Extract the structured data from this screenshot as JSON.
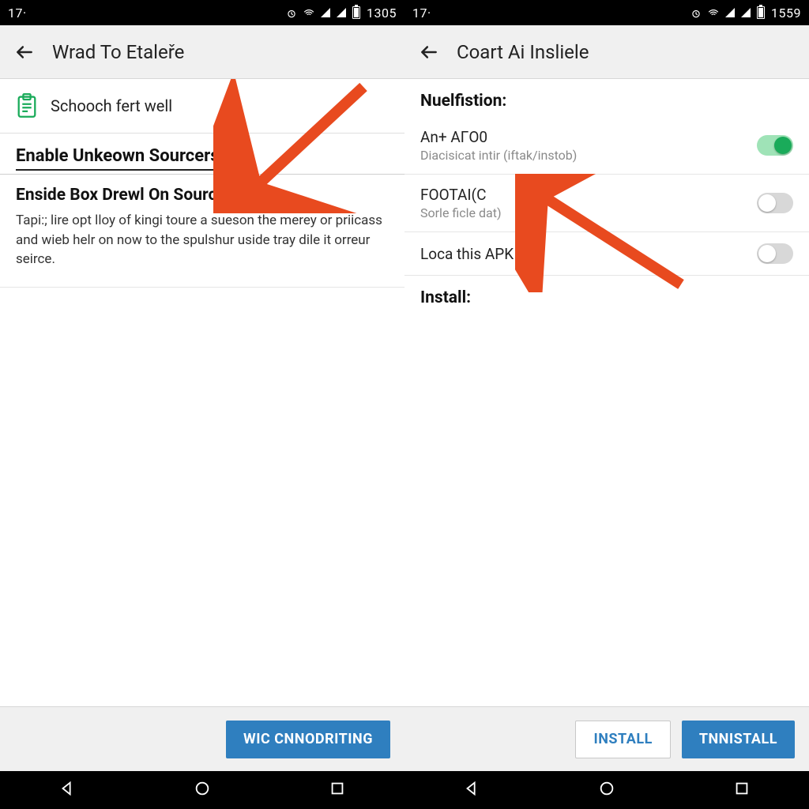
{
  "colors": {
    "accent_blue": "#2f7fbf",
    "accent_green": "#1aab5a",
    "arrow": "#e84a1f"
  },
  "left": {
    "statusbar": {
      "left": "17·",
      "time": "1305"
    },
    "appbar": {
      "title": "Wrad To Etaleře"
    },
    "row1": {
      "label": "Schooch fert well"
    },
    "section_title": "Enable Unkeown Sourcers",
    "para": {
      "heading": "Enside Box Drewl On Sourcer",
      "body": "Tapi:; lire opt lloy of kingi toure a sueson the merey or priicass and wieb helr on now to the spulshur uside tray dile it orreur seirce."
    },
    "footer": {
      "primary": "WIC CNNODRITING"
    }
  },
  "right": {
    "statusbar": {
      "left": "17·",
      "time": "1559"
    },
    "appbar": {
      "title": "Coart Ai Insliele"
    },
    "heading1": "Nuelfistion:",
    "settings": [
      {
        "title": "An+ AΓO0",
        "subtitle": "Diacisicat intir (iftak/instob)",
        "on": true
      },
      {
        "title": "FOOTAI(C",
        "subtitle": "Sorle ficle dat)",
        "on": false
      },
      {
        "title": "Loca this APK",
        "subtitle": "",
        "on": false
      }
    ],
    "heading2": "Install:",
    "footer": {
      "outline": "INSTALL",
      "primary": "TNNISTALL"
    }
  }
}
